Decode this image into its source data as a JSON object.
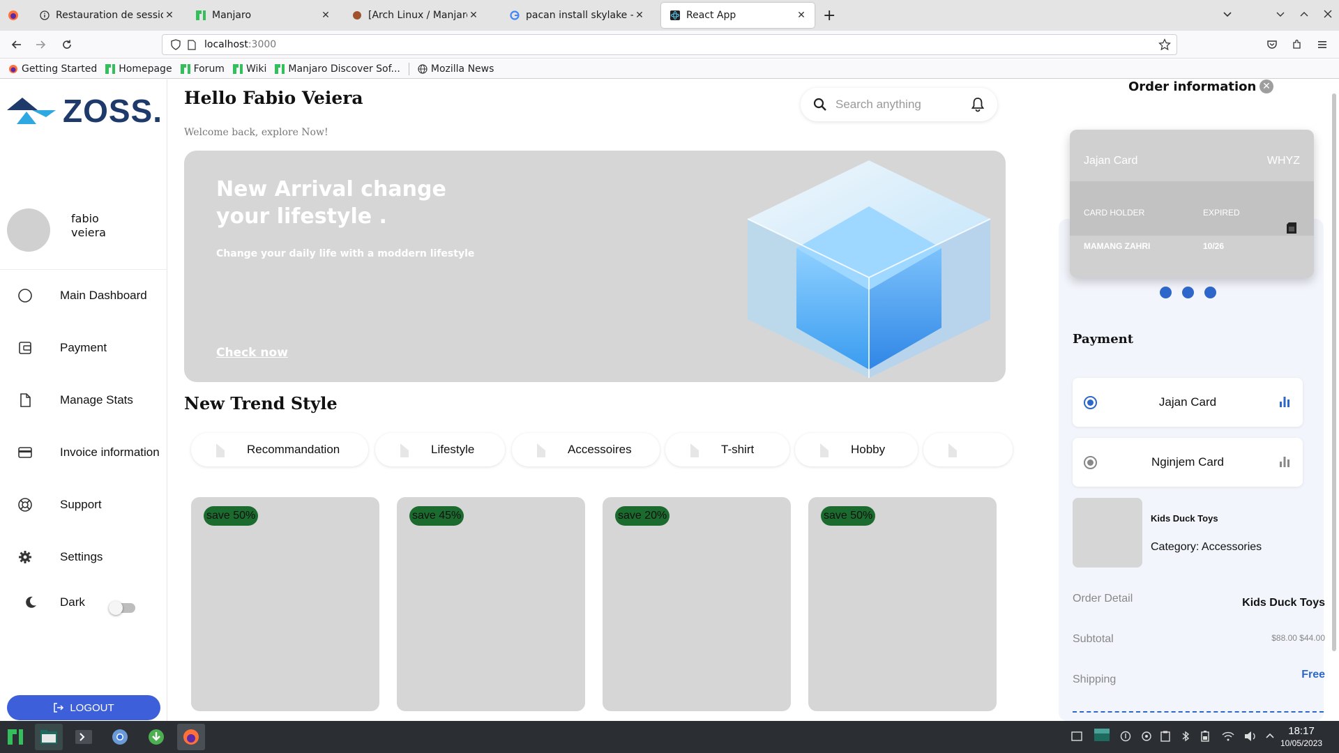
{
  "browser": {
    "tabs": [
      {
        "label": "Restauration de session",
        "close": "✕"
      },
      {
        "label": "Manjaro",
        "close": "✕"
      },
      {
        "label": "[Arch Linux / Manjaro] Opt",
        "close": "✕"
      },
      {
        "label": "pacan install skylake - Rech",
        "close": "✕"
      },
      {
        "label": "React App",
        "close": "✕"
      }
    ],
    "new_tab": "+",
    "url_host": "localhost",
    "url_port": ":3000",
    "bookmarks": [
      "Getting Started",
      "Homepage",
      "Forum",
      "Wiki",
      "Manjaro Discover Sof...",
      "Mozilla News"
    ]
  },
  "sidebar": {
    "brand": "ZOSS.",
    "user_name": "fabio veiera",
    "menu": [
      {
        "label": "Main Dashboard"
      },
      {
        "label": "Payment"
      },
      {
        "label": "Manage Stats"
      },
      {
        "label": "Invoice information"
      },
      {
        "label": "Support"
      },
      {
        "label": "Settings"
      }
    ],
    "dark_label": "Dark",
    "dark_on": false,
    "logout_label": "LOGOUT"
  },
  "header": {
    "greeting": "Hello Fabio Veiera",
    "welcome": "Welcome back, explore Now!",
    "search_placeholder": "Search anything"
  },
  "hero": {
    "title": "New Arrival change your lifestyle .",
    "subtitle": "Change your daily life with a moddern lifestyle",
    "link": "Check now"
  },
  "trend": {
    "title": "New Trend Style",
    "categories": [
      "Recommandation",
      "Lifestyle",
      "Accessoires",
      "T-shirt",
      "Hobby",
      ""
    ],
    "products": [
      {
        "badge": "save 50%"
      },
      {
        "badge": "save 45%"
      },
      {
        "badge": "save 20%"
      },
      {
        "badge": "save 50%"
      }
    ]
  },
  "order": {
    "title": "Order information",
    "card": {
      "name": "Jajan Card",
      "brand": "WHYZ",
      "holder_label": "CARD HOLDER",
      "expired_label": "EXPIRED",
      "holder": "MAMANG ZAHRI",
      "expiry": "10/26"
    },
    "payment_title": "Payment",
    "payment_methods": [
      {
        "label": "Jajan Card",
        "selected": true
      },
      {
        "label": "Nginjem Card",
        "selected": false
      }
    ],
    "product_name": "Kids Duck Toys",
    "product_category": "Category: Accessories",
    "detail_label": "Order Detail",
    "detail_value": "Kids Duck Toys",
    "subtotal_label": "Subtotal",
    "subtotal_value": "$88.00 $44.00",
    "shipping_label": "Shipping",
    "shipping_value": "Free"
  },
  "taskbar": {
    "time": "18:17",
    "date": "10/05/2023"
  },
  "colors": {
    "accent": "#2d67c9",
    "logout": "#3d5fd9",
    "badge": "#1c6b2e",
    "brand": "#1e3a6b"
  }
}
